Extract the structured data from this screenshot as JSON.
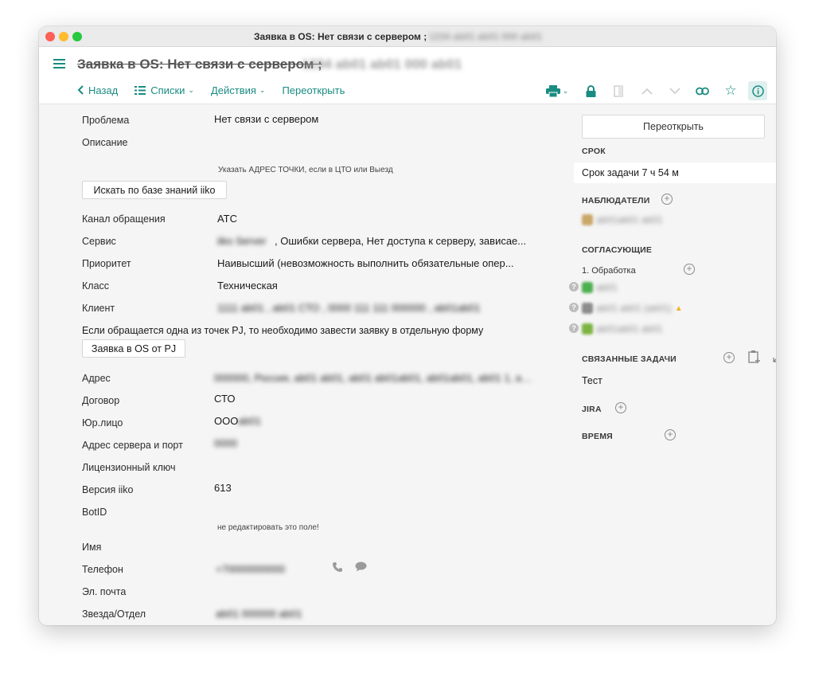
{
  "window": {
    "title": "Заявка в OS: Нет связи  с сервером ;",
    "title_hidden": "1234 ab01 ab01 000 ab01"
  },
  "header": {
    "page_title": "Заявка в OS: Нет связи  с сервером ;",
    "page_title_hidden": "1234 ab01 ab01 000 ab01",
    "toolbar": {
      "back": "Назад",
      "lists": "Списки",
      "actions": "Действия",
      "reopen": "Переоткрыть"
    }
  },
  "form": {
    "problem_label": "Проблема",
    "problem_value": "Нет связи  с сервером",
    "description_label": "Описание",
    "address_hint": "Указать АДРЕС ТОЧКИ, если в ЦТО или Выезд",
    "kb_search_button": "Искать по базе знаний iiko",
    "channel_label": "Канал обращения",
    "channel_value": "АТС",
    "service_label": "Сервис",
    "service_hidden": "iiko Server",
    "service_value": ", Ошибки сервера, Нет доступа к серверу, зависае...",
    "priority_label": "Приоритет",
    "priority_value": "Наивысший (невозможность выполнить обязательные опер...",
    "class_label": "Класс",
    "class_value": "Техническая",
    "client_label": "Клиент",
    "client_hidden": "1111 ab01 , ab01 СТО , 0000 111 111 000000 , ab01ab01",
    "pj_note": "Если обращается одна из точек PJ, то необходимо завести заявку в отдельную форму",
    "pj_button": "Заявка в OS от PJ",
    "address_label": "Адрес",
    "address_hidden": "000000, Россия, ab01 ab01, ab01 ab01ab01, ab01ab01, ab01 1, ab01",
    "contract_label": "Договор",
    "contract_value": "СТО",
    "legal_label": "Юр.лицо",
    "legal_value": "ООО",
    "legal_hidden": "ab01",
    "server_label": "Адрес сервера и порт",
    "server_hidden": "0000",
    "license_label": "Лицензионный ключ",
    "version_label": "Версия iiko",
    "version_value": "613",
    "botid_label": "BotID",
    "botid_hint": "не редактировать это поле!",
    "name_label": "Имя",
    "phone_label": "Телефон",
    "phone_hidden": "+70000000000",
    "email_label": "Эл. почта",
    "star_label": "Звезда/Отдел",
    "star_hidden": "ab01 000000 ab01"
  },
  "sidebar": {
    "reopen_button": "Переоткрыть",
    "deadline_title": "СРОК",
    "deadline_value": "Срок задачи 7 ч 54 м",
    "watchers_title": "НАБЛЮДАТЕЛИ",
    "watcher_hidden": "ab01ab01 ab01",
    "approvers_title": "СОГЛАСУЮЩИЕ",
    "stage_label": "1. Обработка",
    "approvers_hidden": [
      "ab01",
      "ab01 ab01 (ab01)",
      "ab01ab01 ab01"
    ],
    "linked_title": "СВЯЗАННЫЕ ЗАДАЧИ",
    "linked_task": "Тест",
    "jira_title": "JIRA",
    "time_title": "ВРЕМЯ"
  },
  "colors": {
    "accent": "#1a8c82",
    "avatar_green": "#4caf50",
    "avatar_amber": "#c9a86a",
    "avatar_gray": "#8c8c8c",
    "avatar_olive": "#7cb342"
  },
  "icons": [
    "menu-icon",
    "back-chevron-icon",
    "list-icon",
    "chevron-down-icon",
    "print-icon",
    "lock-icon",
    "document-icon",
    "arrow-up-icon",
    "arrow-down-icon",
    "link-icon",
    "star-icon",
    "info-icon",
    "phone-icon",
    "chat-icon",
    "plus-circle-icon",
    "add-linked-task-icon",
    "expand-icon",
    "question-icon",
    "thumbs-up-icon"
  ]
}
